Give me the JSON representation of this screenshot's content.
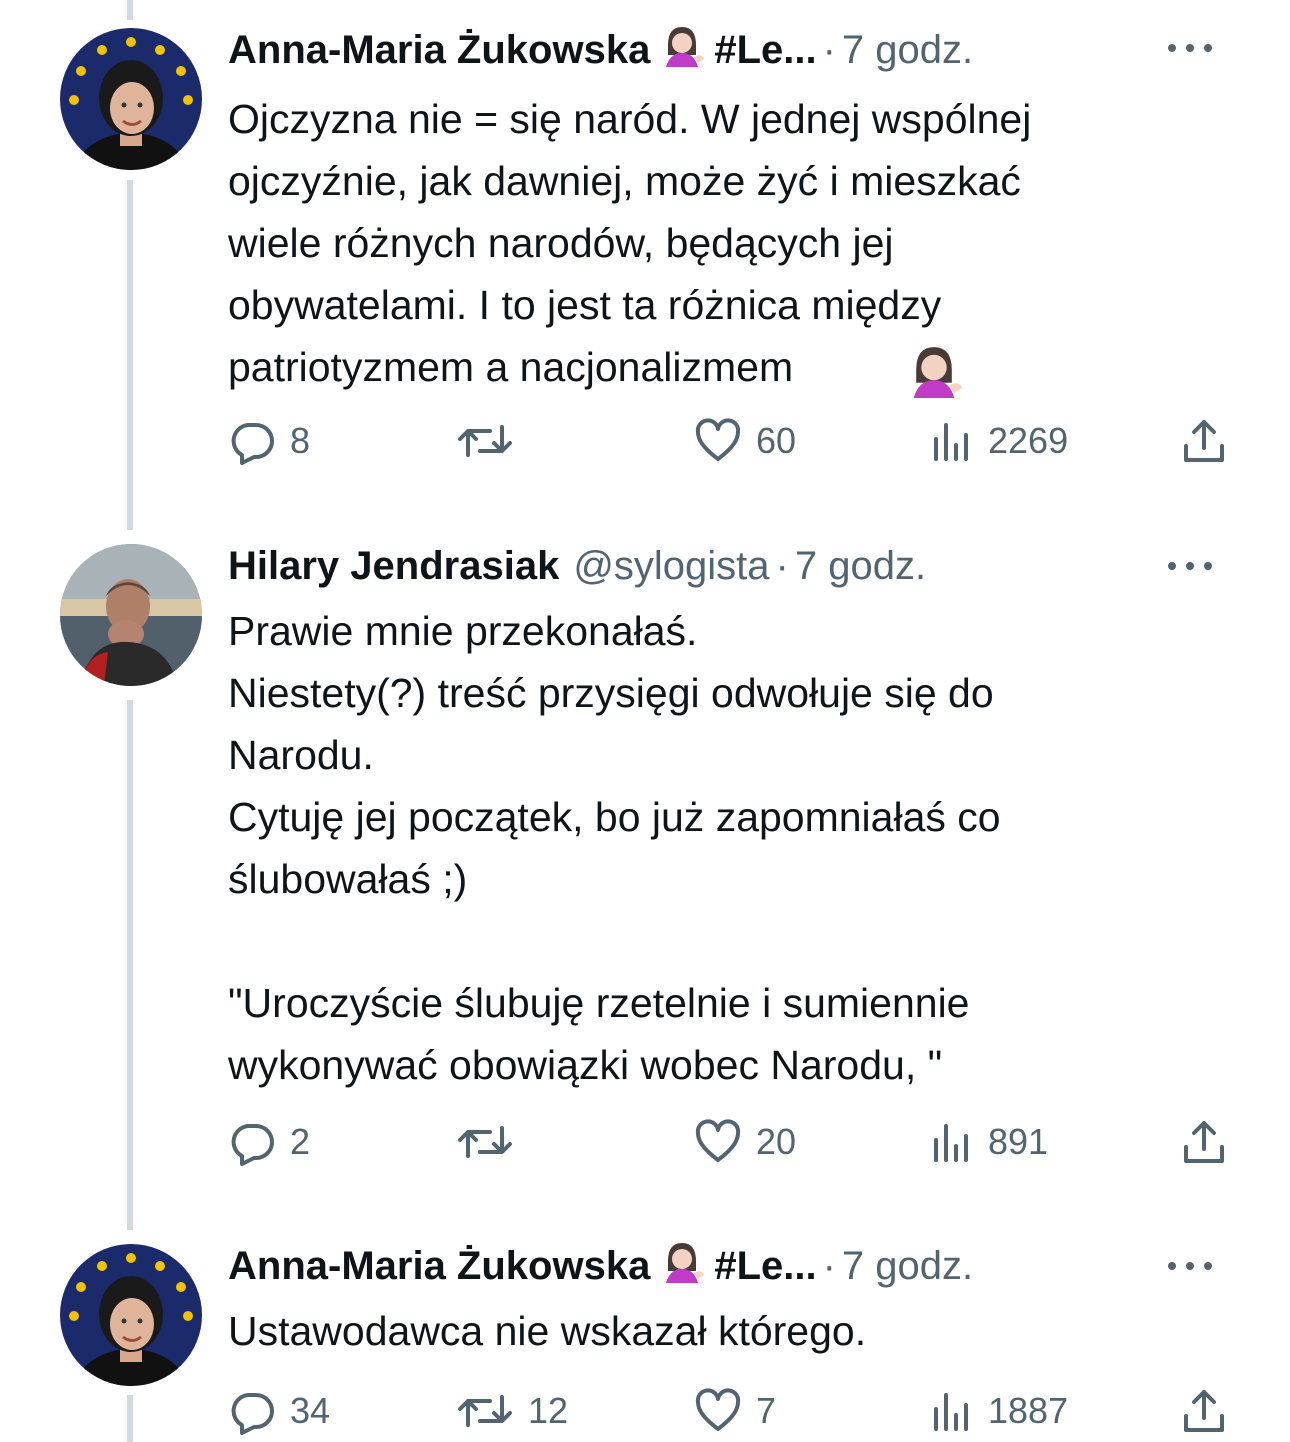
{
  "tweets": [
    {
      "name": "Anna-Maria Żukowska",
      "name_suffix": "#Le...",
      "handle": "",
      "separator": "·",
      "time": "7 godz.",
      "text": "Ojczyzna nie = się naród. W jednej wspólnej\nojczyźnie, jak dawniej, może żyć i mieszkać\nwiele różnych narodów, będących jej\nobywatelami. I to jest ta różnica między\npatriotyzmem a nacjonalizmem",
      "replies": "8",
      "retweets": "",
      "likes": "60",
      "views": "2269"
    },
    {
      "name": "Hilary Jendrasiak",
      "name_suffix": "",
      "handle": "@sylogista",
      "separator": "·",
      "time": "7 godz.",
      "text": "Prawie mnie przekonałaś.\nNiestety(?) treść przysięgi odwołuje się do\nNarodu.\nCytuję jej początek, bo już zapomniałaś co\nślubowałaś ;)\n\n\"Uroczyście ślubuję rzetelnie i sumiennie\nwykonywać obowiązki wobec Narodu, \"",
      "replies": "2",
      "retweets": "",
      "likes": "20",
      "views": "891"
    },
    {
      "name": "Anna-Maria Żukowska",
      "name_suffix": "#Le...",
      "handle": "",
      "separator": "·",
      "time": "7 godz.",
      "text": "Ustawodawca nie wskazał którego.",
      "replies": "34",
      "retweets": "12",
      "likes": "7",
      "views": "1887"
    }
  ],
  "icons": {
    "reply": "reply-icon",
    "retweet": "retweet-icon",
    "like": "heart-icon",
    "views": "views-icon",
    "share": "share-icon",
    "more": "more-icon",
    "emoji": "woman-tipping-hand-emoji"
  },
  "colors": {
    "text": "#0f1419",
    "secondary": "#536471",
    "thread_line": "#cfd9de",
    "avatar_eu_blue": "#1b2a6b",
    "avatar_star": "#f2c200"
  }
}
